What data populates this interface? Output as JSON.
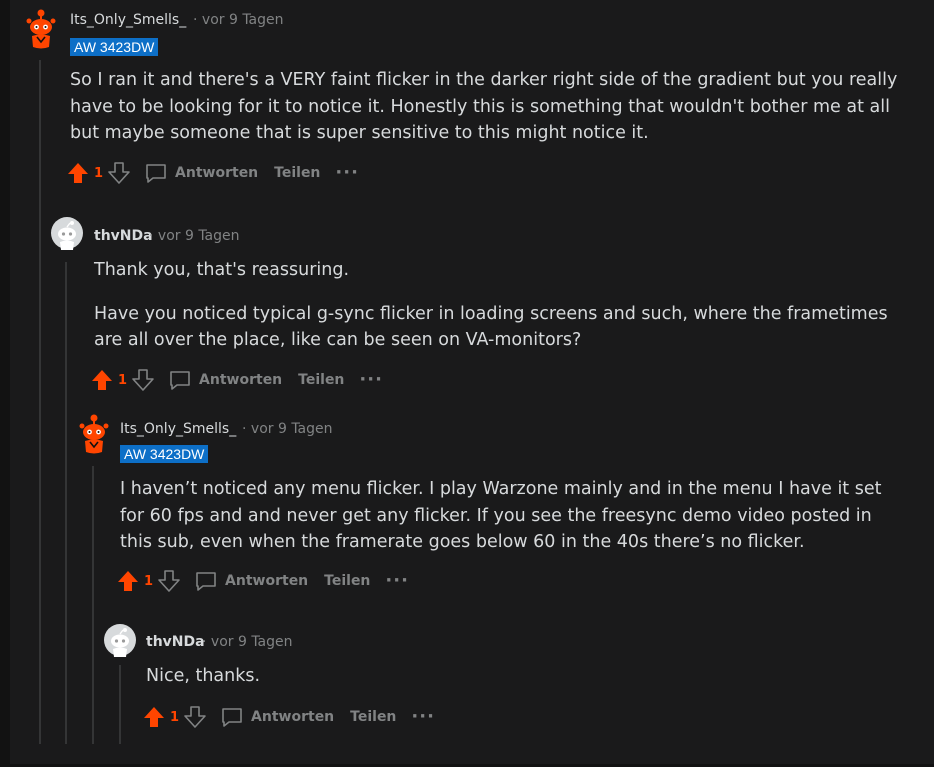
{
  "colors": {
    "background": "#1a1a1b",
    "text": "#d7dadc",
    "muted": "#818384",
    "upvote": "#ff4500",
    "flair_bg": "#0d6fc7",
    "thread_line": "#343536"
  },
  "comments": [
    {
      "author": "Its_Only_Smells_",
      "separator": "·",
      "time": "vor 9 Tagen",
      "flair": "AW 3423DW",
      "paragraphs": [
        "So I ran it and there's a VERY faint flicker in the darker right side of the gradient but you really have to be looking for it to notice it. Honestly this is something that wouldn't bother me at all but maybe someone that is super sensitive to this might notice it."
      ],
      "votes": "1",
      "reply_label": "Antworten",
      "share_label": "Teilen",
      "more_label": "···",
      "avatar_icon": "snoo-avatar-icon"
    },
    {
      "author": "thvNDa",
      "separator": "·",
      "time": "vor 9 Tagen",
      "paragraphs": [
        "Thank you, that's reassuring.",
        "Have you noticed typical g-sync flicker in loading screens and such, where the frametimes are all over the place, like can be seen on VA-monitors?"
      ],
      "votes": "1",
      "reply_label": "Antworten",
      "share_label": "Teilen",
      "more_label": "···",
      "avatar_icon": "default-snoo-avatar-icon"
    },
    {
      "author": "Its_Only_Smells_",
      "separator": "·",
      "time": "vor 9 Tagen",
      "flair": "AW 3423DW",
      "paragraphs": [
        "I haven’t noticed any menu flicker. I play Warzone mainly and in the menu I have it set for 60 fps and and never get any flicker. If you see the freesync demo video posted in this sub, even when the framerate goes below 60 in the 40s there’s no flicker."
      ],
      "votes": "1",
      "reply_label": "Antworten",
      "share_label": "Teilen",
      "more_label": "···",
      "avatar_icon": "snoo-avatar-icon"
    },
    {
      "author": "thvNDa",
      "separator": "·",
      "time": "vor 9 Tagen",
      "paragraphs": [
        "Nice, thanks."
      ],
      "votes": "1",
      "reply_label": "Antworten",
      "share_label": "Teilen",
      "more_label": "···",
      "avatar_icon": "default-snoo-avatar-icon"
    }
  ]
}
